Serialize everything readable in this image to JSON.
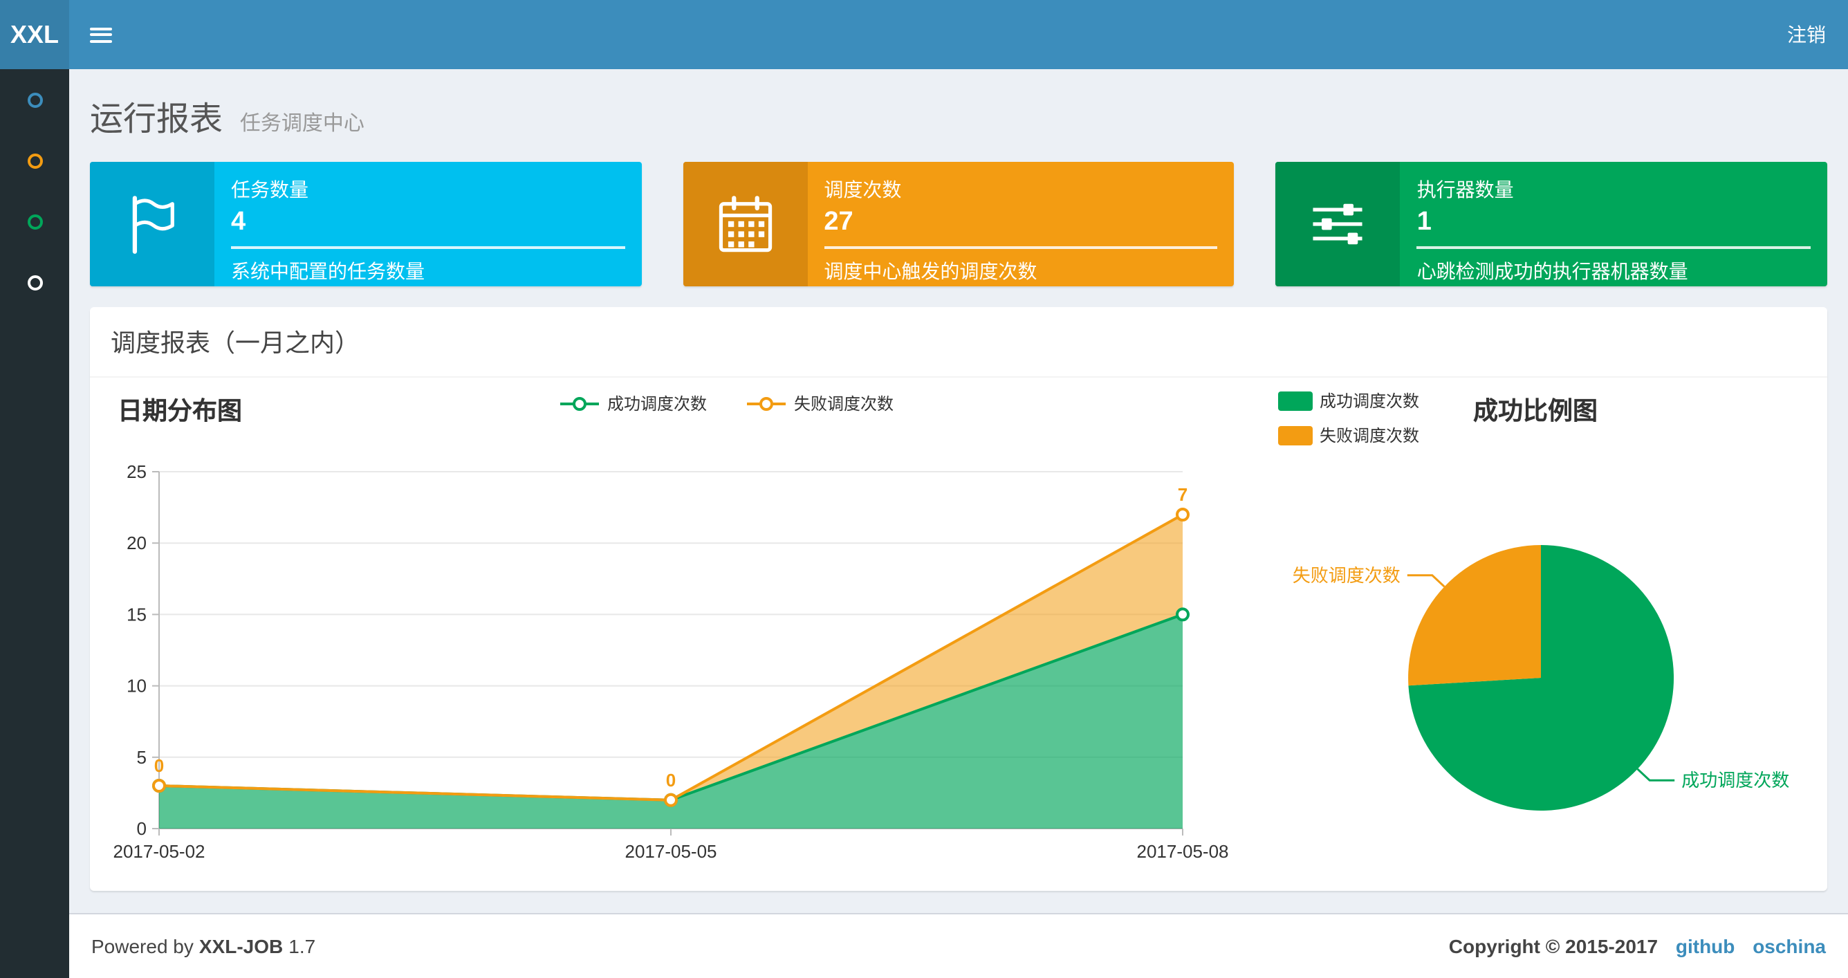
{
  "navbar": {
    "logo_text": "XXL",
    "logout_label": "注销"
  },
  "sidebar": {
    "items": [
      {
        "icon": "circle-icon",
        "color": "#3c8dbc"
      },
      {
        "icon": "circle-icon",
        "color": "#f39c12"
      },
      {
        "icon": "circle-icon",
        "color": "#00a65a"
      },
      {
        "icon": "circle-icon",
        "color": "#ffffff"
      }
    ]
  },
  "page_header": {
    "title": "运行报表",
    "subtitle": "任务调度中心"
  },
  "info_boxes": [
    {
      "label": "任务数量",
      "value": "4",
      "description": "系统中配置的任务数量",
      "bg": "#00c0ef",
      "icon_bg": "#00a7d0",
      "icon": "flag-icon"
    },
    {
      "label": "调度次数",
      "value": "27",
      "description": "调度中心触发的调度次数",
      "bg": "#f39c12",
      "icon_bg": "#d9890f",
      "icon": "calendar-icon"
    },
    {
      "label": "执行器数量",
      "value": "1",
      "description": "心跳检测成功的执行器机器数量",
      "bg": "#00a65a",
      "icon_bg": "#008f4e",
      "icon": "sliders-icon"
    }
  ],
  "panel": {
    "title": "调度报表（一月之内）"
  },
  "chart_data": [
    {
      "type": "area",
      "title": "日期分布图",
      "x": [
        "2017-05-02",
        "2017-05-05",
        "2017-05-08"
      ],
      "series": [
        {
          "name": "成功调度次数",
          "values": [
            3,
            2,
            15
          ],
          "color": "#00a65a"
        },
        {
          "name": "失败调度次数",
          "values": [
            0,
            0,
            7
          ],
          "color": "#f39c12",
          "stacked_on": "成功调度次数"
        }
      ],
      "point_labels_series": "失败调度次数",
      "ylim": [
        0,
        25
      ],
      "yticks": [
        0,
        5,
        10,
        15,
        20,
        25
      ],
      "grid": true,
      "legend_position": "top-center"
    },
    {
      "type": "pie",
      "title": "成功比例图",
      "slices": [
        {
          "name": "成功调度次数",
          "value": 20,
          "color": "#00a65a"
        },
        {
          "name": "失败调度次数",
          "value": 7,
          "color": "#f39c12"
        }
      ],
      "total": 27,
      "legend_position": "top-left"
    }
  ],
  "footer": {
    "powered_by_prefix": "Powered by",
    "product": "XXL-JOB",
    "version": "1.7",
    "copyright": "Copyright © 2015-2017",
    "links": [
      {
        "label": "github"
      },
      {
        "label": "oschina"
      }
    ]
  }
}
